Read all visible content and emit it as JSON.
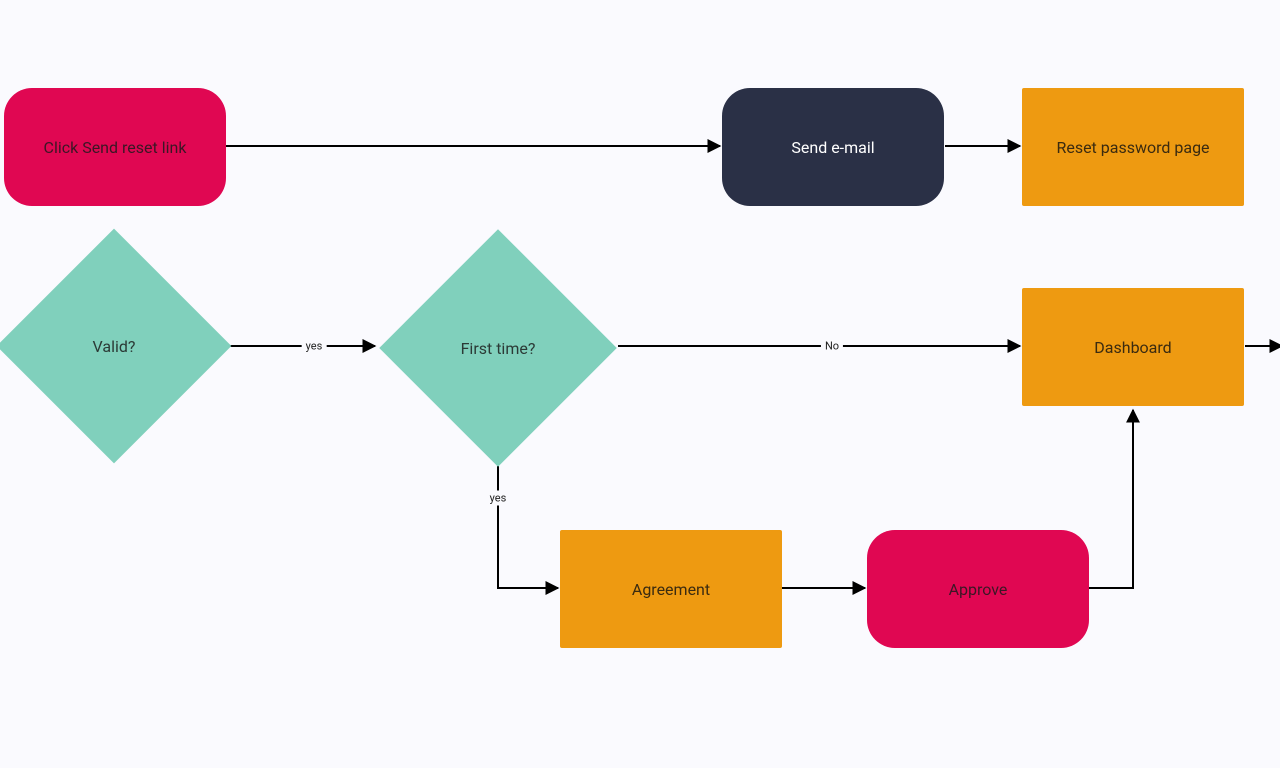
{
  "nodes": {
    "click_send_reset": {
      "label": "Click Send reset link",
      "type": "action",
      "color": "#e00752"
    },
    "send_email": {
      "label": "Send e-mail",
      "type": "process",
      "color": "#2a3046"
    },
    "reset_password_page": {
      "label": "Reset password page",
      "type": "page",
      "color": "#ee9a11"
    },
    "valid": {
      "label": "Valid?",
      "type": "decision",
      "color": "#80d0bc"
    },
    "first_time": {
      "label": "First time?",
      "type": "decision",
      "color": "#80d0bc"
    },
    "dashboard": {
      "label": "Dashboard",
      "type": "page",
      "color": "#ee9a11"
    },
    "agreement": {
      "label": "Agreement",
      "type": "page",
      "color": "#ee9a11"
    },
    "approve": {
      "label": "Approve",
      "type": "action",
      "color": "#e00752"
    }
  },
  "edges": {
    "click_to_email": {
      "label": ""
    },
    "email_to_reset": {
      "label": ""
    },
    "into_valid": {
      "label": ""
    },
    "valid_to_first": {
      "label": "yes"
    },
    "first_to_dashboard": {
      "label": "No"
    },
    "dashboard_out": {
      "label": ""
    },
    "first_to_agreement": {
      "label": "yes"
    },
    "agreement_to_approve": {
      "label": ""
    },
    "approve_to_dashboard": {
      "label": ""
    }
  }
}
